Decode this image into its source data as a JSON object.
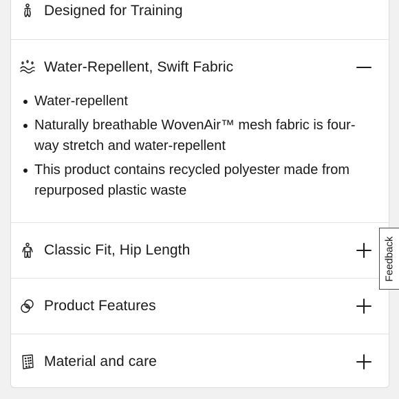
{
  "sections": [
    {
      "title": "Designed for Training",
      "icon": "training-figure-icon",
      "expanded": false,
      "toggle": "none"
    },
    {
      "title": "Water-Repellent, Swift Fabric",
      "icon": "water-drops-icon",
      "expanded": true,
      "toggle": "minus"
    },
    {
      "title": "Classic Fit, Hip Length",
      "icon": "fit-figure-icon",
      "expanded": false,
      "toggle": "plus"
    },
    {
      "title": "Product Features",
      "icon": "features-icon",
      "expanded": false,
      "toggle": "plus"
    },
    {
      "title": "Material and care",
      "icon": "fabric-swatch-icon",
      "expanded": false,
      "toggle": "plus"
    }
  ],
  "fabric_details": {
    "bullets": [
      "Water-repellent",
      "Naturally breathable WovenAir™ mesh fabric is four-way stretch and water-repellent",
      "This product contains recycled polyester made from repurposed plastic waste"
    ]
  },
  "feedback": {
    "label": "Feedback"
  }
}
